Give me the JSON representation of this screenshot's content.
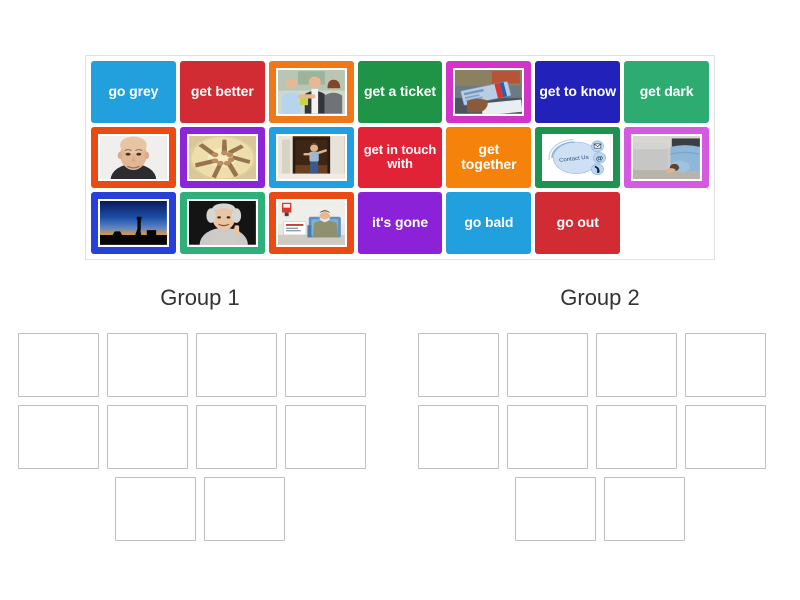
{
  "activity": {
    "type": "group-sort",
    "tray": {
      "columns": 7,
      "rows": 3,
      "tiles": [
        {
          "id": "t1",
          "kind": "text",
          "label": "go grey",
          "color": "#229fdd"
        },
        {
          "id": "t2",
          "kind": "text",
          "label": "get better",
          "color": "#d12b33"
        },
        {
          "id": "t3",
          "kind": "image",
          "label": "",
          "color": "#f07818",
          "image": "handshake-business-people-photo"
        },
        {
          "id": "t4",
          "kind": "text",
          "label": "get a ticket",
          "color": "#1f9346"
        },
        {
          "id": "t5",
          "kind": "image",
          "label": "",
          "color": "#d234c8",
          "image": "hand-holding-tickets-photo"
        },
        {
          "id": "t6",
          "kind": "text",
          "label": "get to know",
          "color": "#2222bb"
        },
        {
          "id": "t7",
          "kind": "text",
          "label": "get dark",
          "color": "#2eab71"
        },
        {
          "id": "t8",
          "kind": "image",
          "label": "",
          "color": "#ec4a12",
          "image": "bald-man-portrait-photo"
        },
        {
          "id": "t9",
          "kind": "image",
          "label": "",
          "color": "#8b25d8",
          "image": "hands-joined-circle-photo"
        },
        {
          "id": "t10",
          "kind": "image",
          "label": "",
          "color": "#219fe0",
          "image": "child-at-doorway-photo"
        },
        {
          "id": "t11",
          "kind": "text",
          "label": "get in touch with",
          "color": "#e02337"
        },
        {
          "id": "t12",
          "kind": "text",
          "label": "get together",
          "color": "#f5820b"
        },
        {
          "id": "t13",
          "kind": "image",
          "label": "",
          "color": "#1d9350",
          "image": "contact-us-graphic"
        },
        {
          "id": "t14",
          "kind": "image",
          "label": "",
          "color": "#d45ae0",
          "image": "person-looking-under-bed-photo"
        },
        {
          "id": "t15",
          "kind": "image",
          "label": "",
          "color": "#2741d8",
          "image": "dusk-sunset-silhouette-photo"
        },
        {
          "id": "t16",
          "kind": "image",
          "label": "",
          "color": "#2fb07a",
          "image": "grey-haired-woman-portrait-photo"
        },
        {
          "id": "t17",
          "kind": "image",
          "label": "",
          "color": "#ec4a12",
          "image": "patient-in-hospital-bed-photo"
        },
        {
          "id": "t18",
          "kind": "text",
          "label": "it's gone",
          "color": "#8b22d8"
        },
        {
          "id": "t19",
          "kind": "text",
          "label": "go bald",
          "color": "#229fdd"
        },
        {
          "id": "t20",
          "kind": "text",
          "label": "go out",
          "color": "#d12b33"
        },
        {
          "id": "t21",
          "kind": "empty",
          "label": "",
          "color": "transparent"
        }
      ]
    },
    "groups": [
      {
        "title": "Group 1",
        "rows": [
          {
            "centered": false,
            "slots": 4
          },
          {
            "centered": false,
            "slots": 4
          },
          {
            "centered": true,
            "slots": 2
          }
        ]
      },
      {
        "title": "Group 2",
        "rows": [
          {
            "centered": false,
            "slots": 4
          },
          {
            "centered": false,
            "slots": 4
          },
          {
            "centered": true,
            "slots": 2
          }
        ]
      }
    ]
  }
}
